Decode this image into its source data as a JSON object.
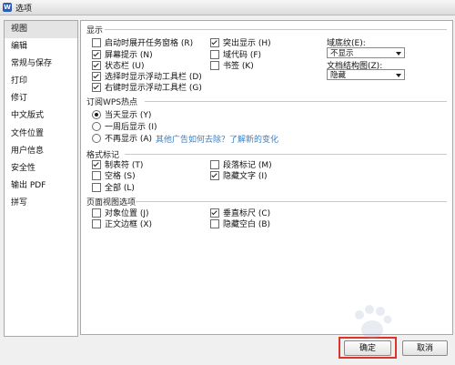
{
  "window": {
    "title": "选项"
  },
  "sidebar": {
    "items": [
      {
        "label": "视图",
        "selected": true
      },
      {
        "label": "编辑"
      },
      {
        "label": "常规与保存"
      },
      {
        "label": "打印"
      },
      {
        "label": "修订"
      },
      {
        "label": "中文版式"
      },
      {
        "label": "文件位置"
      },
      {
        "label": "用户信息"
      },
      {
        "label": "安全性"
      },
      {
        "label": "输出 PDF"
      },
      {
        "label": "拼写"
      }
    ]
  },
  "display": {
    "title": "显示",
    "options": [
      {
        "label": "启动时展开任务窗格 (R)",
        "checked": false
      },
      {
        "label": "屏幕提示 (N)",
        "checked": true
      },
      {
        "label": "状态栏 (U)",
        "checked": true
      },
      {
        "label": "选择时显示浮动工具栏 (D)",
        "checked": true
      },
      {
        "label": "右键时显示浮动工具栏 (G)",
        "checked": true
      },
      {
        "label": "突出显示 (H)",
        "checked": true
      },
      {
        "label": "域代码 (F)",
        "checked": false
      },
      {
        "label": "书签 (K)",
        "checked": false
      }
    ],
    "field_shading": {
      "label": "域底纹(E):",
      "value": "不显示"
    },
    "doc_map": {
      "label": "文档结构图(Z):",
      "value": "隐藏"
    }
  },
  "wps_hot": {
    "title": "订阅WPS热点",
    "options": [
      {
        "label": "当天显示 (Y)",
        "checked": true
      },
      {
        "label": "一周后显示 (I)",
        "checked": false
      },
      {
        "label": "不再显示 (A)",
        "checked": false
      }
    ],
    "link": "其他广告如何去除？了解新的变化"
  },
  "format_marks": {
    "title": "格式标记",
    "options": [
      {
        "label": "制表符 (T)",
        "checked": true
      },
      {
        "label": "空格 (S)",
        "checked": false
      },
      {
        "label": "全部 (L)",
        "checked": false
      },
      {
        "label": "段落标记 (M)",
        "checked": false
      },
      {
        "label": "隐藏文字 (I)",
        "checked": true
      }
    ]
  },
  "page_view": {
    "title": "页面视图选项",
    "options": [
      {
        "label": "对象位置 (J)",
        "checked": false
      },
      {
        "label": "正文边框 (X)",
        "checked": false
      },
      {
        "label": "垂直标尺 (C)",
        "checked": true
      },
      {
        "label": "隐藏空白 (B)",
        "checked": false
      }
    ]
  },
  "buttons": {
    "ok": "确定",
    "cancel": "取消"
  }
}
